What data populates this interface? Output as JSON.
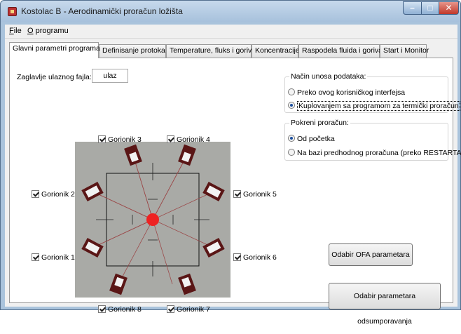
{
  "window": {
    "title": "Kostolac B - Aerodinamički proračun ložišta"
  },
  "menu": [
    {
      "underline": "F",
      "rest": "ile"
    },
    {
      "underline": "O",
      "rest": " programu"
    }
  ],
  "tabs": [
    "Glavni parametri programa",
    "Definisanje protoka",
    "Temperature, fluks i gorivo",
    "Koncentracije",
    "Raspodela fluida i goriva",
    "Start i Monitor"
  ],
  "form": {
    "input_file_label": "Zaglavlje ulaznog fajla:",
    "input_file_value": "ulaz"
  },
  "entry_mode": {
    "title": "Način unosa podataka:",
    "options": [
      "Preko ovog korisničkog interfejsa",
      "Kuplovanjem sa programom za termički proračun"
    ],
    "selected": 1
  },
  "start_calc": {
    "title": "Pokreni proračun:",
    "options": [
      "Od početka",
      "Na bazi predhodnog proračuna (preko RESTARTA)"
    ],
    "selected": 0
  },
  "burners": [
    {
      "label": "Gorionik 1",
      "checked": true
    },
    {
      "label": "Gorionik 2",
      "checked": true
    },
    {
      "label": "Gorionik 3",
      "checked": true
    },
    {
      "label": "Gorionik 4",
      "checked": true
    },
    {
      "label": "Gorionik 5",
      "checked": true
    },
    {
      "label": "Gorionik 6",
      "checked": true
    },
    {
      "label": "Gorionik 7",
      "checked": true
    },
    {
      "label": "Gorionik 8",
      "checked": true
    }
  ],
  "buttons": {
    "ofa": "Odabir OFA parametara",
    "desulf": "Odabir parametara odsumporavanja"
  },
  "colors": {
    "diagram_bg": "#a9aaa6",
    "burner_body": "#5a1616",
    "burner_nozzle": "#f2f2f2",
    "flame": "#ee2222",
    "jet_line": "#9b4b4b"
  }
}
